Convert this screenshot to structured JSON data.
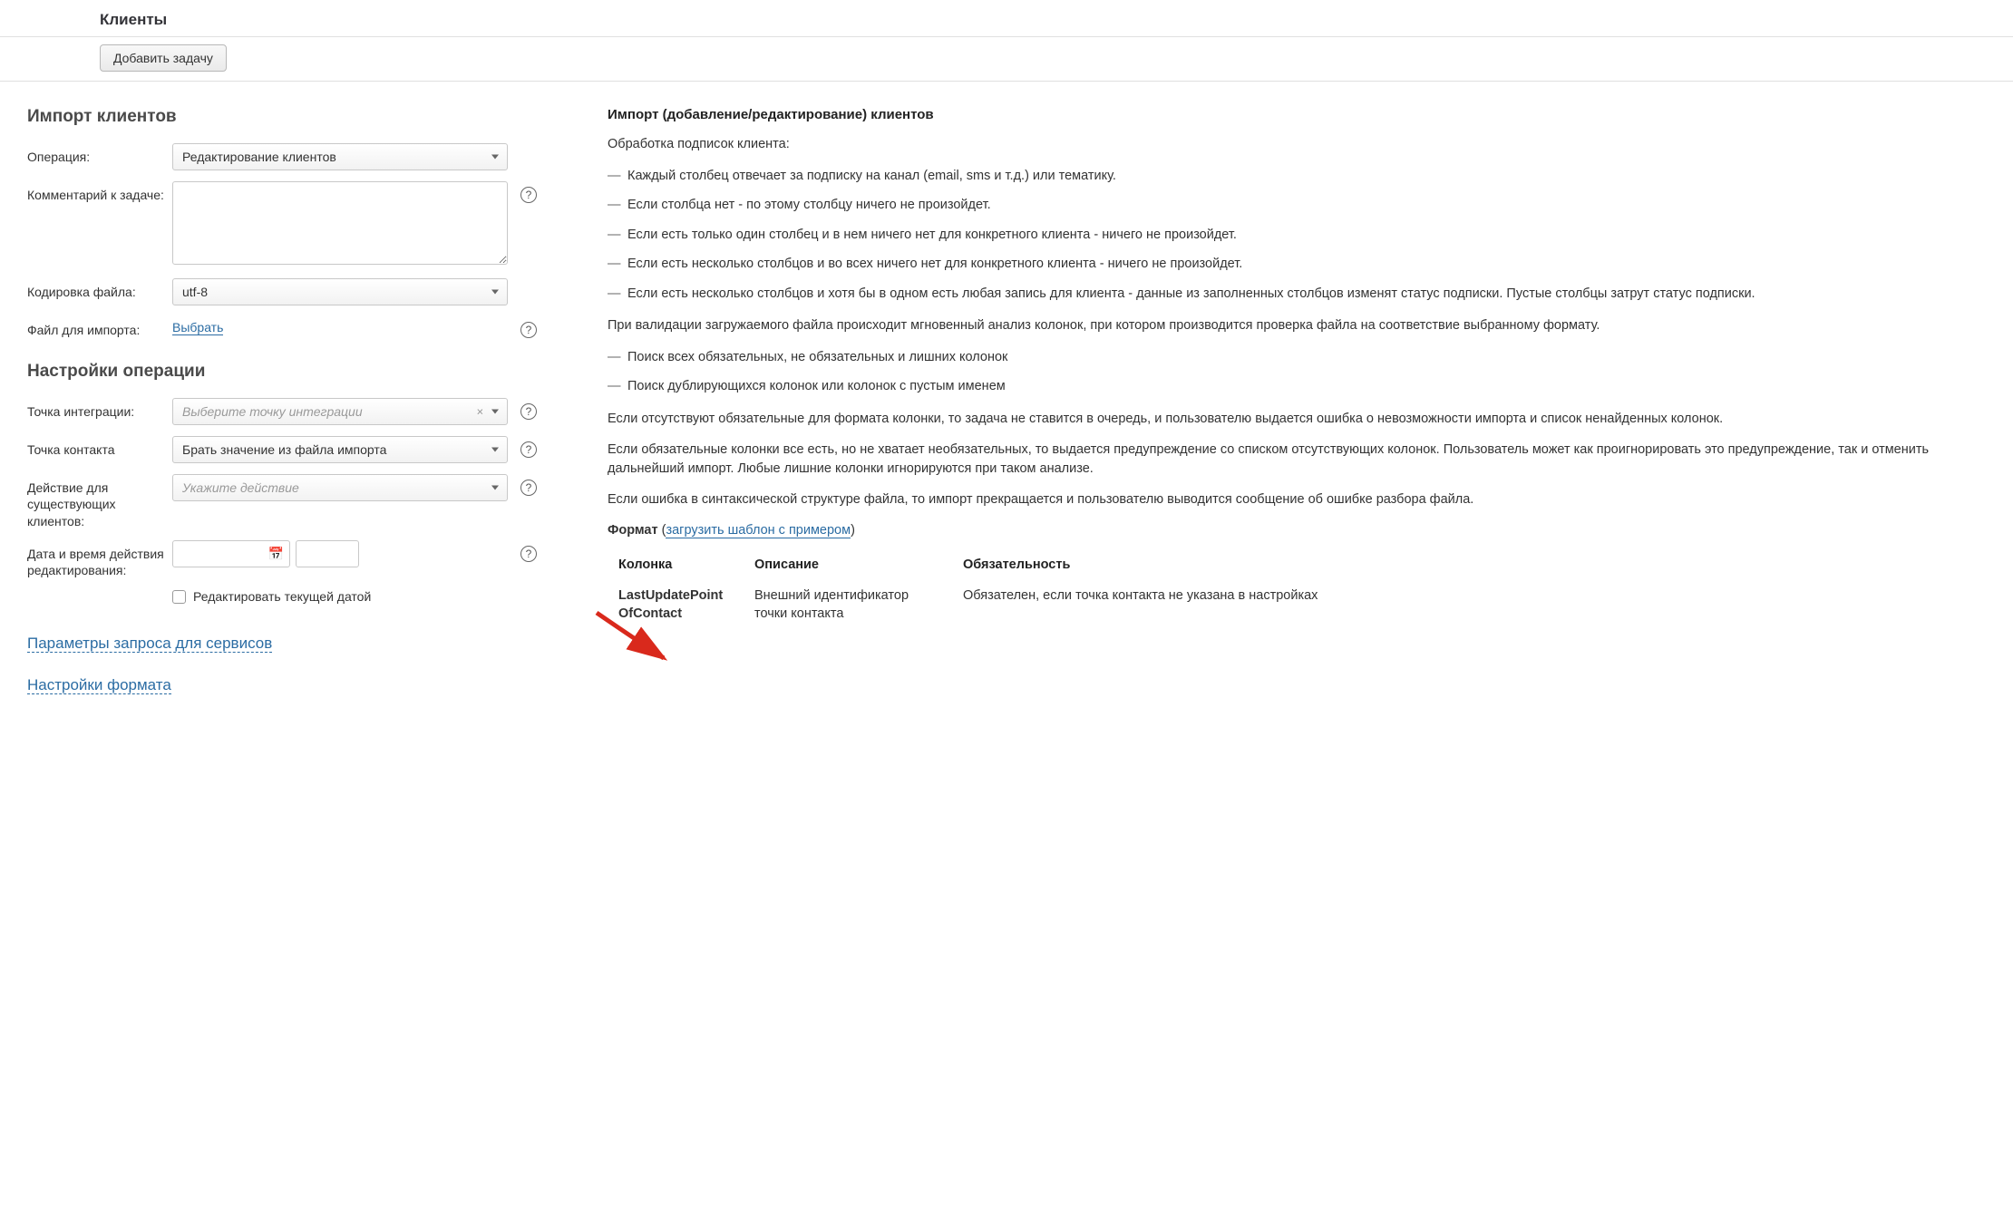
{
  "header": {
    "title": "Клиенты"
  },
  "toolbar": {
    "add_task": "Добавить задачу"
  },
  "left": {
    "section_import": "Импорт клиентов",
    "operation_label": "Операция:",
    "operation_value": "Редактирование клиентов",
    "comment_label": "Комментарий к задаче:",
    "encoding_label": "Кодировка файла:",
    "encoding_value": "utf-8",
    "file_label": "Файл для импорта:",
    "file_choose": "Выбрать",
    "section_settings": "Настройки операции",
    "integration_label": "Точка интеграции:",
    "integration_placeholder": "Выберите точку интеграции",
    "contact_label": "Точка контакта",
    "contact_value": "Брать значение из файла импорта",
    "action_label": "Действие для существующих клиентов:",
    "action_placeholder": "Укажите действие",
    "datetime_label": "Дата и время действия редактирования:",
    "checkbox_label": "Редактировать текущей датой",
    "params_link": "Параметры запроса для сервисов",
    "format_link": "Настройки формата"
  },
  "right": {
    "title": "Импорт (добавление/редактирование) клиентов",
    "subs_heading": "Обработка подписок клиента:",
    "subs_items": [
      "Каждый столбец отвечает за подписку на канал (email, sms и т.д.) или тематику.",
      "Если столбца нет - по этому столбцу ничего не произойдет.",
      "Если есть только один столбец и в нем ничего нет для конкретного клиента - ничего не произойдет.",
      "Если есть несколько столбцов и во всех ничего нет для конкретного клиента - ничего не произойдет.",
      "Если есть несколько столбцов и хотя бы в одном есть любая запись для клиента - данные из заполненных столбцов изменят статус подписки. Пустые столбцы затрут статус подписки."
    ],
    "validation_p": "При валидации загружаемого файла происходит мгновенный анализ колонок, при котором производится проверка файла на соответствие выбранному формату.",
    "validation_items": [
      "Поиск всех обязательных, не обязательных и лишних колонок",
      "Поиск дублирующихся колонок или колонок с пустым именем"
    ],
    "missing_required_p": "Если отсутствуют обязательные для формата колонки, то задача не ставится в очередь, и пользователю выдается ошибка о невозможности импорта и список ненайденных колонок.",
    "missing_optional_p": "Если обязательные колонки все есть, но не хватает необязательных, то выдается предупреждение со списком отсутствующих колонок. Пользователь может как проигнорировать это предупреждение, так и отменить дальнейший импорт. Любые лишние колонки игнорируются при таком анализе.",
    "syntax_error_p": "Если ошибка в синтаксической структуре файла, то импорт прекращается и пользователю выводится сообщение об ошибке разбора файла.",
    "format_label": "Формат",
    "format_link": "загрузить шаблон с примером",
    "table": {
      "headers": [
        "Колонка",
        "Описание",
        "Обязательность"
      ],
      "rows": [
        {
          "col": "LastUpdatePointOfContact",
          "desc": "Внешний идентификатор точки контакта",
          "req": "Обязателен, если точка контакта не указана в настройках"
        }
      ]
    }
  }
}
